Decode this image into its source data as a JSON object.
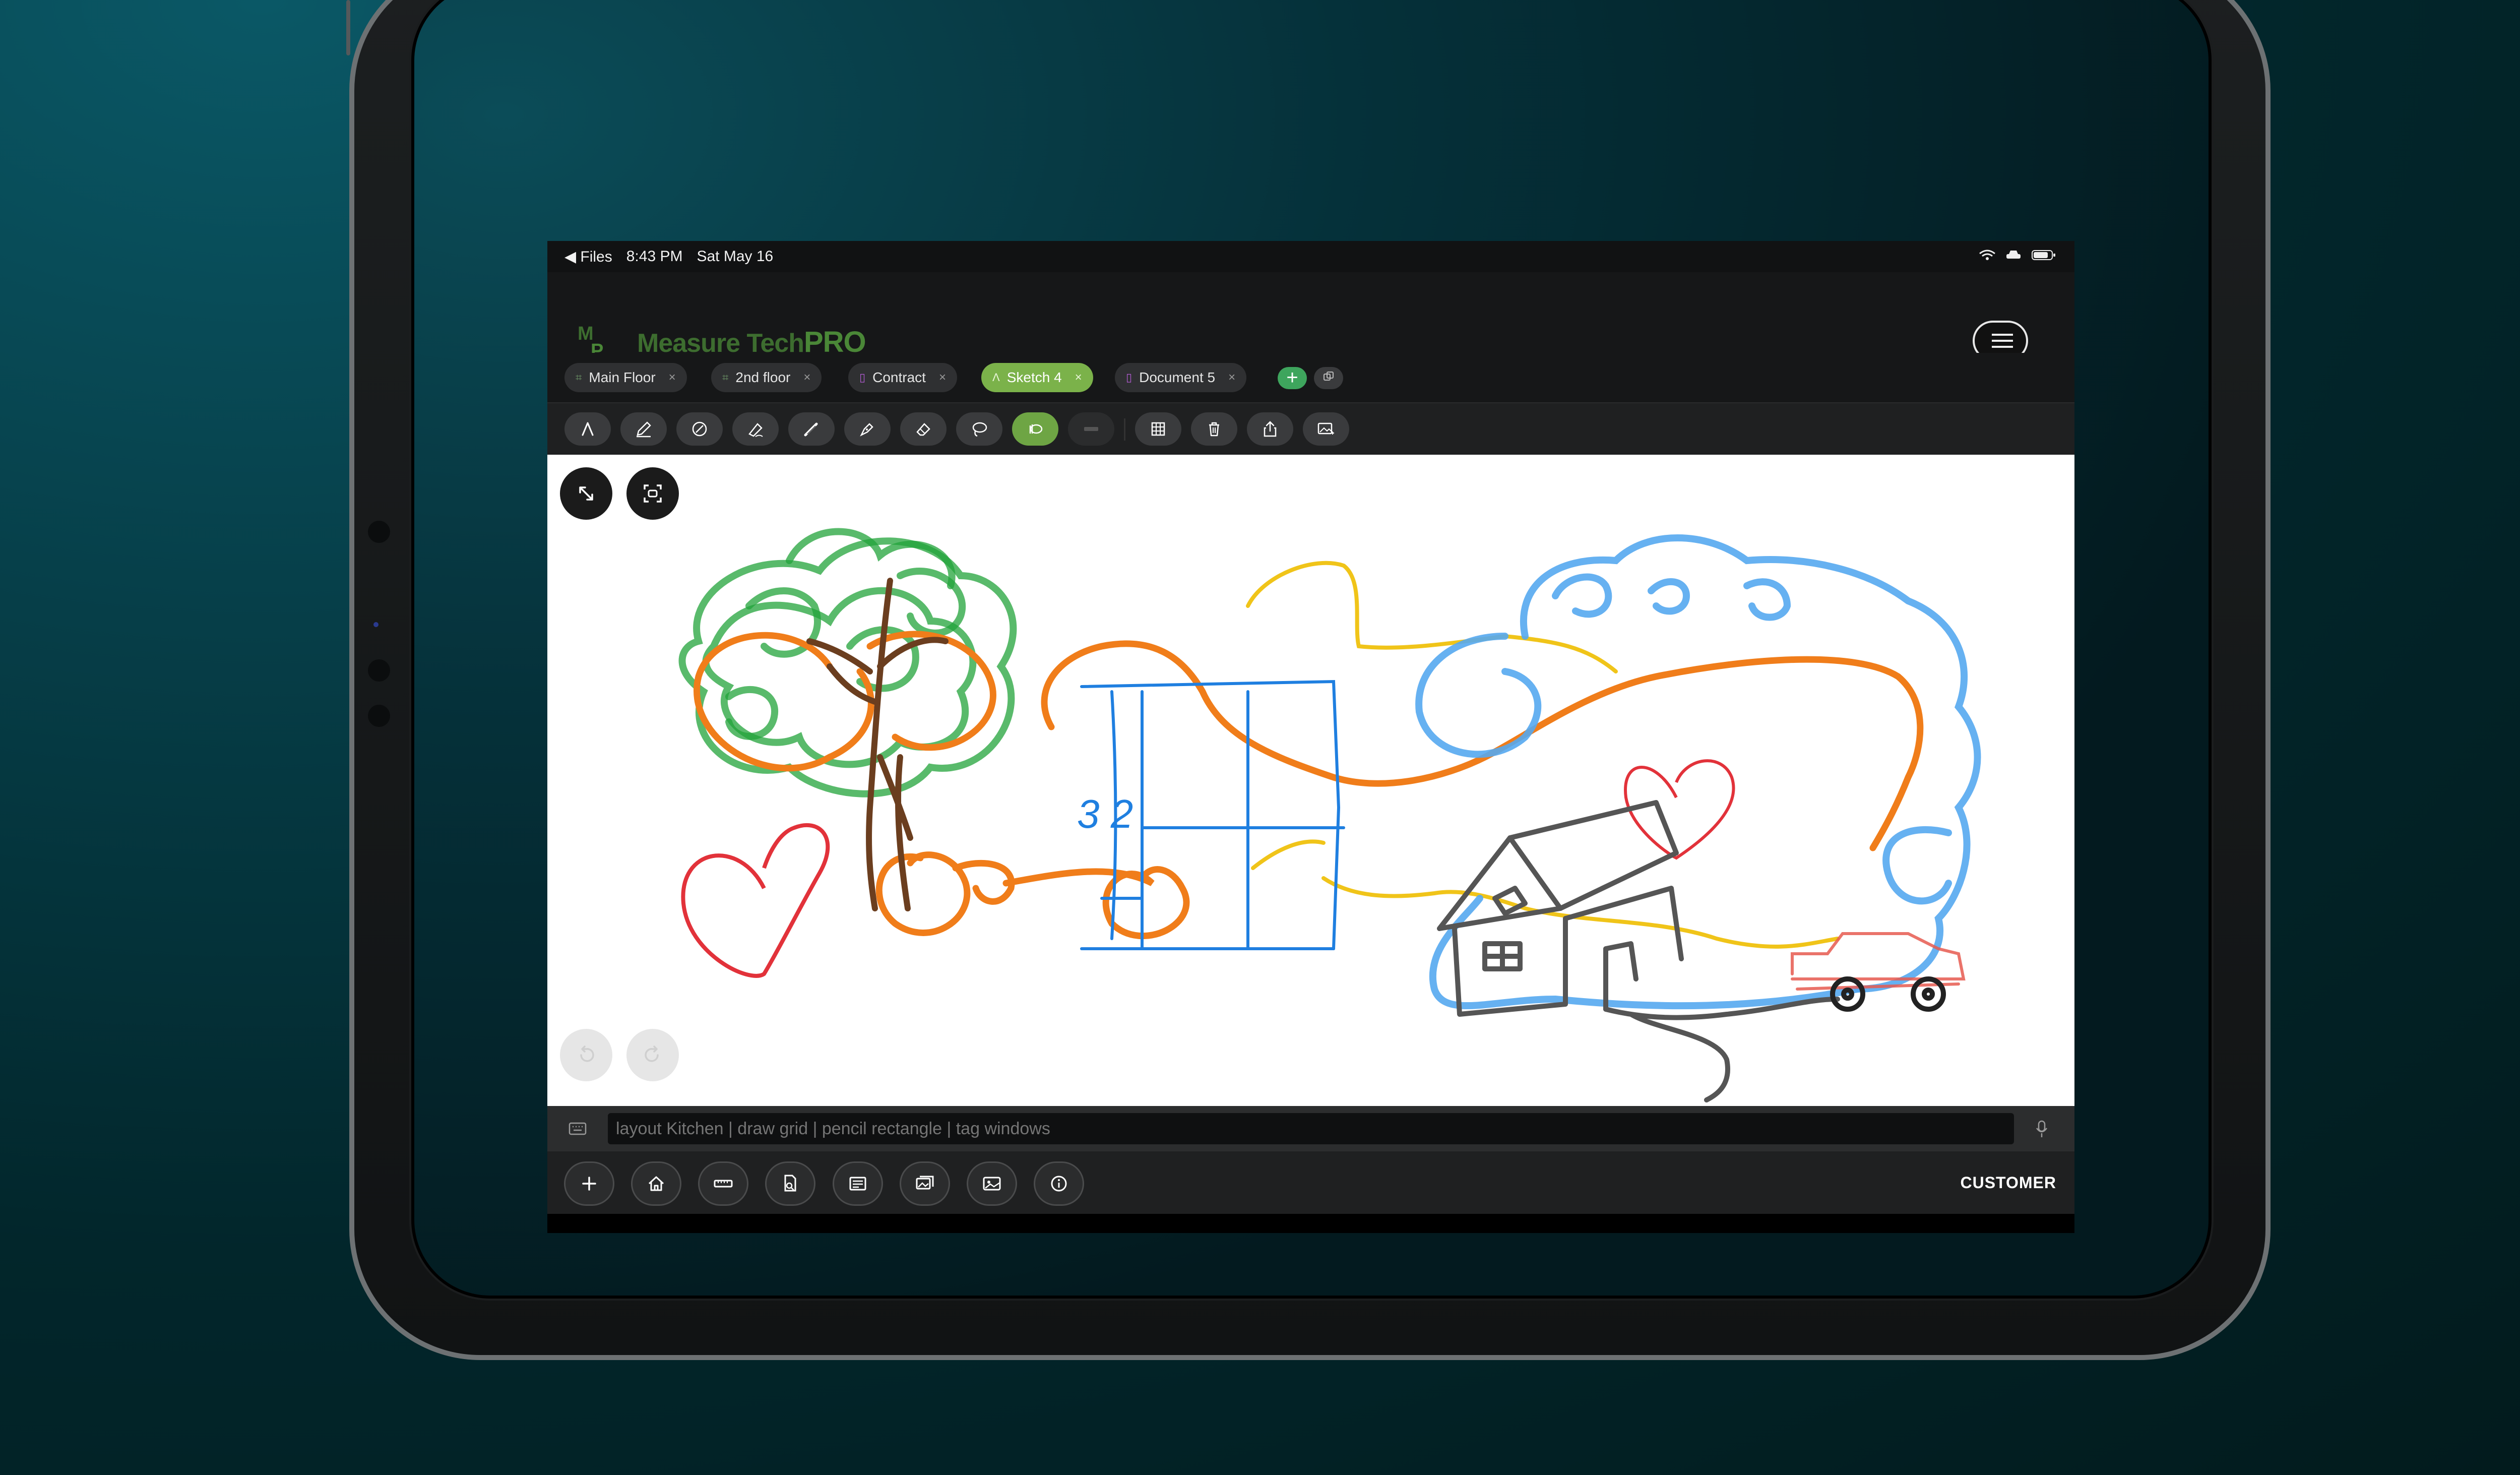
{
  "status_bar": {
    "back_app": "◀ Files",
    "time": "8:43 PM",
    "date": "Sat May 16"
  },
  "header": {
    "logo_part1": "Measure Tech",
    "logo_part2": "PRO"
  },
  "tabs": [
    {
      "label": "Main Floor",
      "kind": "sketch",
      "active": false
    },
    {
      "label": "2nd floor",
      "kind": "sketch",
      "active": false
    },
    {
      "label": "Contract",
      "kind": "document",
      "active": false
    },
    {
      "label": "Sketch 4",
      "kind": "sketch",
      "active": true
    },
    {
      "label": "Document 5",
      "kind": "document",
      "active": false
    }
  ],
  "tab_add_label": "+",
  "tab_close_glyph": "×",
  "command_bar": {
    "placeholder": "layout Kitchen | draw grid | pencil rectangle | tag windows"
  },
  "bottom_bar": {
    "customer_label": "CUSTOMER"
  },
  "canvas": {
    "measurement_label": "3 2"
  },
  "colors": {
    "accent_green": "#7bb24a",
    "add_green": "#3ea55d",
    "doc_purple": "#b05bd0"
  },
  "icons": {
    "toolbar": [
      "pen-tip-icon",
      "pencil-icon",
      "highlighter-circle-icon",
      "marker-icon",
      "brush-icon",
      "fountain-pen-icon",
      "eraser-icon",
      "lasso-icon",
      "hand-lasso-icon",
      "ruler-icon",
      "grid-icon",
      "trash-icon",
      "share-icon",
      "image-icon"
    ],
    "bottom": [
      "plus-icon",
      "home-icon",
      "ruler-icon",
      "document-search-icon",
      "form-icon",
      "gallery-icon",
      "camera-card-icon",
      "info-icon"
    ]
  }
}
